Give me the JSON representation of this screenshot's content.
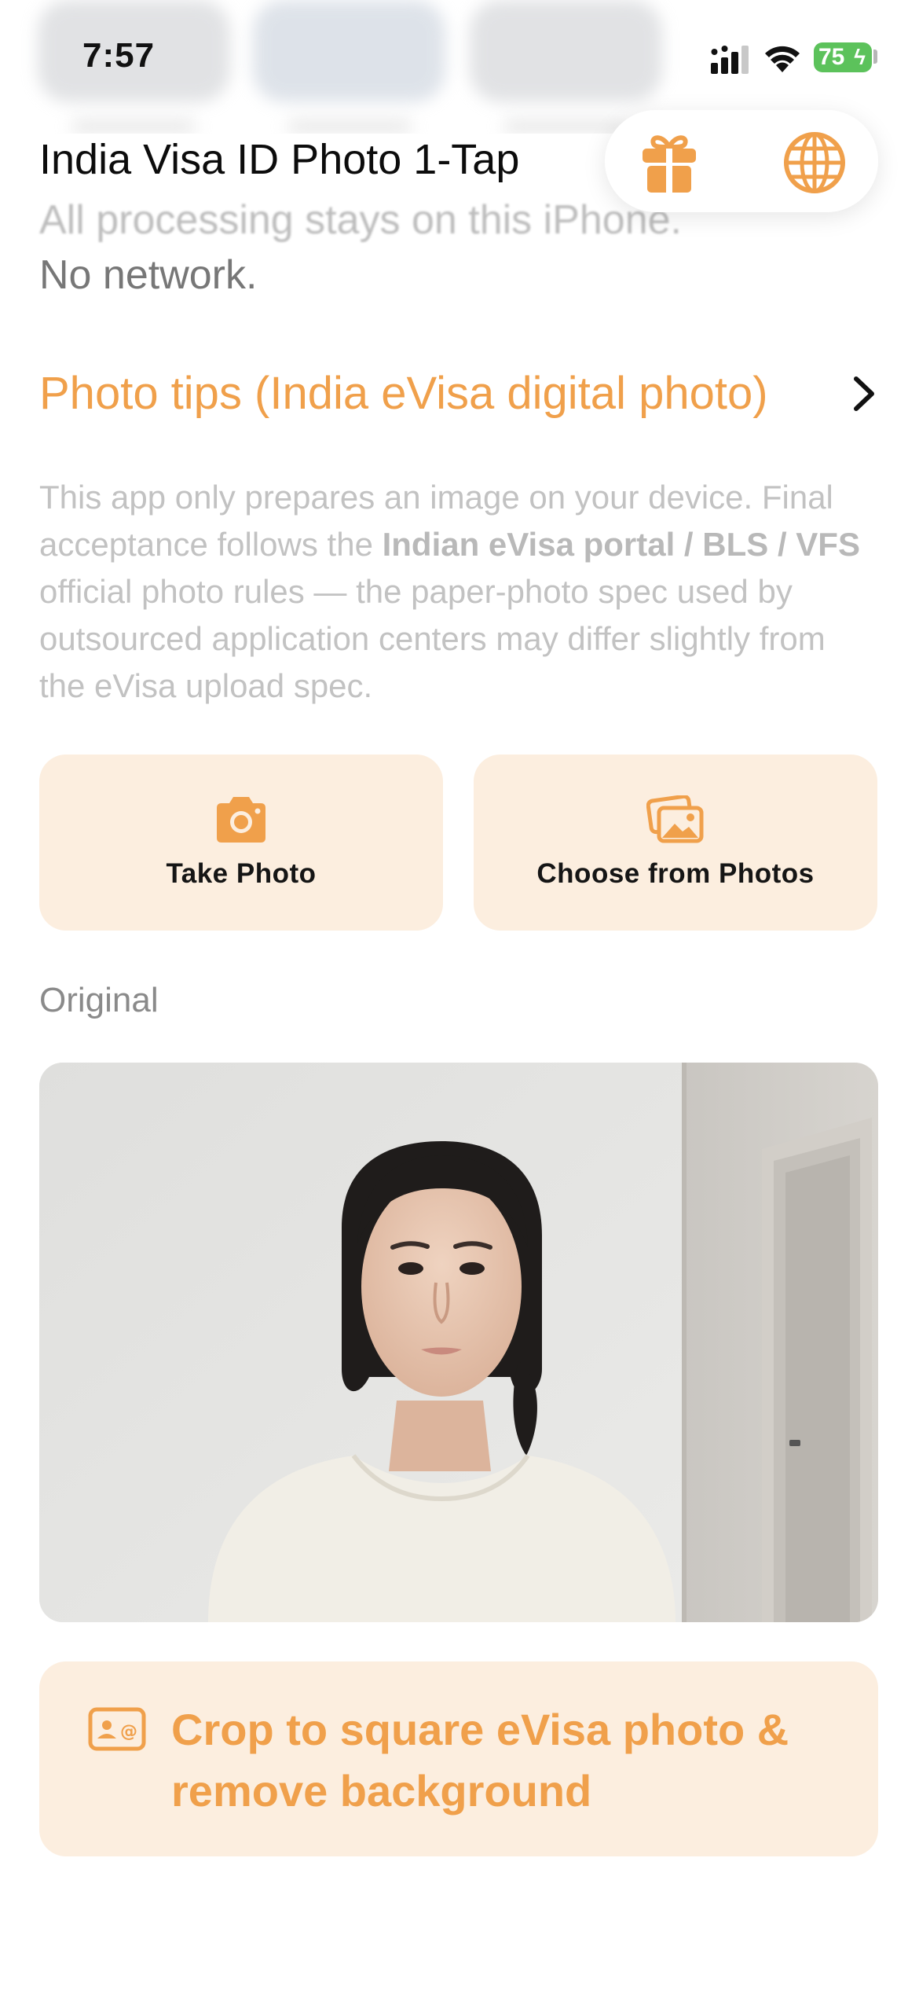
{
  "status_bar": {
    "time": "7:57",
    "battery": "75"
  },
  "header": {
    "title": "India Visa ID Photo 1-Tap",
    "subtitle_line1": "All processing stays on this iPhone.",
    "subtitle_line2": "No network.",
    "icons": [
      "gift-icon",
      "globe-icon"
    ]
  },
  "tips": {
    "label": "Photo tips (India eVisa digital photo)"
  },
  "disclaimer": {
    "part1": "This app only prepares an image on your device. Final acceptance follows the ",
    "bold": "Indian eVisa portal / BLS / VFS",
    "part2": " official photo rules — the paper-photo spec used by outsourced application centers may differ slightly from the eVisa upload spec."
  },
  "actions": {
    "take_photo": "Take Photo",
    "choose_photos": "Choose from Photos"
  },
  "original_label": "Original",
  "crop_button": {
    "label": "Crop to square eVisa photo & remove background"
  },
  "colors": {
    "accent": "#F0A04B",
    "button_bg": "#FCEEDF",
    "battery": "#5CC25B"
  }
}
